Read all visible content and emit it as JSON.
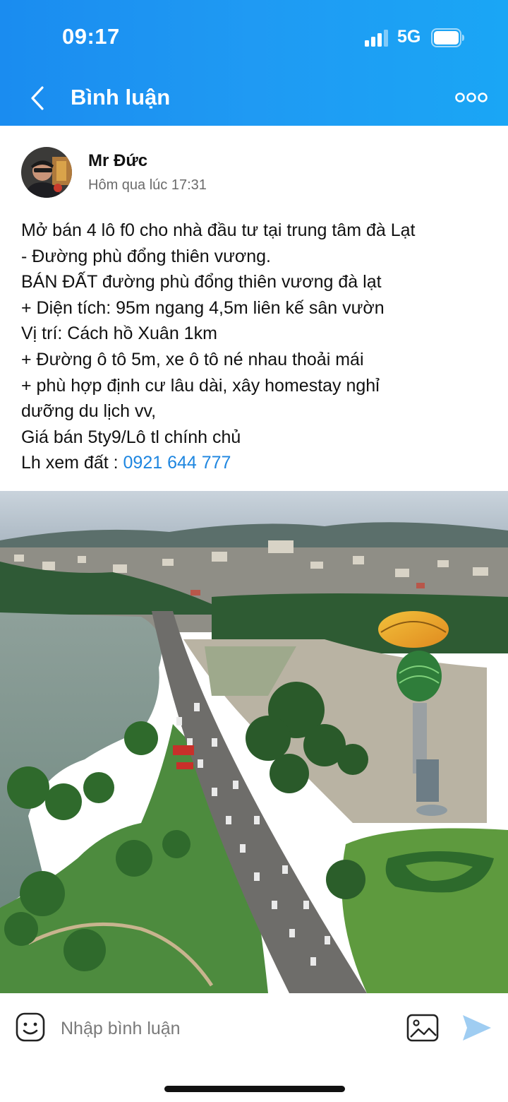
{
  "status_bar": {
    "time": "09:17",
    "network": "5G",
    "icons": [
      "signal-icon",
      "battery-icon"
    ]
  },
  "nav": {
    "title": "Bình luận",
    "back_icon": "chevron-left-icon",
    "more_icon": "more-dots-icon"
  },
  "post": {
    "author": "Mr Đức",
    "timestamp": "Hôm qua lúc 17:31",
    "lines": [
      "Mở bán 4 lô f0 cho nhà đầu tư tại trung tâm đà Lạt",
      "- Đường phù đổng thiên vương.",
      "BÁN ĐẤT đường phù đổng thiên vương đà lạt",
      "+ Diện tích: 95m ngang 4,5m liên kế sân vườn",
      "Vị trí: Cách hồ Xuân 1km",
      "+ Đường ô tô 5m, xe ô tô né nhau thoải mái",
      "+ phù hợp định cư lâu dài, xây homestay nghỉ",
      "dưỡng du lịch vv,",
      "Giá bán 5ty9/Lô tl chính chủ"
    ],
    "contact_prefix": "Lh xem đất : ",
    "phone": "0921 644 777",
    "link_color": "#1e86e0"
  },
  "comment_bar": {
    "placeholder": "Nhập bình luận",
    "icons": [
      "emoji-icon",
      "photo-icon",
      "send-icon"
    ]
  },
  "colors": {
    "header_blue": "#1f9af3",
    "send_disabled": "#9fcdf2"
  }
}
